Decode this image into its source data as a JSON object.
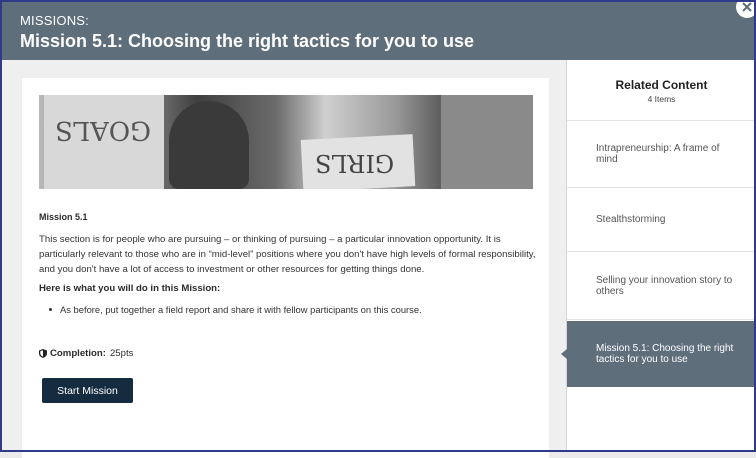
{
  "header": {
    "kicker": "MISSIONS:",
    "title": "Mission 5.1: Choosing the right tactics for you to use"
  },
  "hero": {
    "sign_left_text": "GOALS",
    "sign_middle_text": "GIRLS"
  },
  "mission": {
    "label": "Mission 5.1",
    "description": "This section is for people who are pursuing – or thinking of pursuing – a particular innovation opportunity. It is particularly relevant to those who are in “mid-level” positions where you don't have high levels of formal responsibility, and you don't have a lot of access to investment or other resources for getting things done.",
    "todo_title": "Here is what you will do in this Mission:",
    "todo_items": [
      "As before, put together a field report and share it with fellow participants on this course."
    ],
    "completion_label": "Completion:",
    "completion_value": "25pts",
    "start_button": "Start Mission"
  },
  "sidebar": {
    "title": "Related Content",
    "count": "4 Items",
    "items": [
      {
        "label": "Intrapreneurship: A frame of mind"
      },
      {
        "label": "Stealthstorming"
      },
      {
        "label": "Selling your innovation story to others"
      },
      {
        "label": "Mission 5.1: Choosing the right tactics for you to use"
      }
    ]
  },
  "colors": {
    "header_bg": "#5f6e7b",
    "button_bg": "#152c40",
    "active_item_bg": "#5f6e7b"
  },
  "icons": {
    "close": "close-icon",
    "shield": "shield-icon"
  }
}
